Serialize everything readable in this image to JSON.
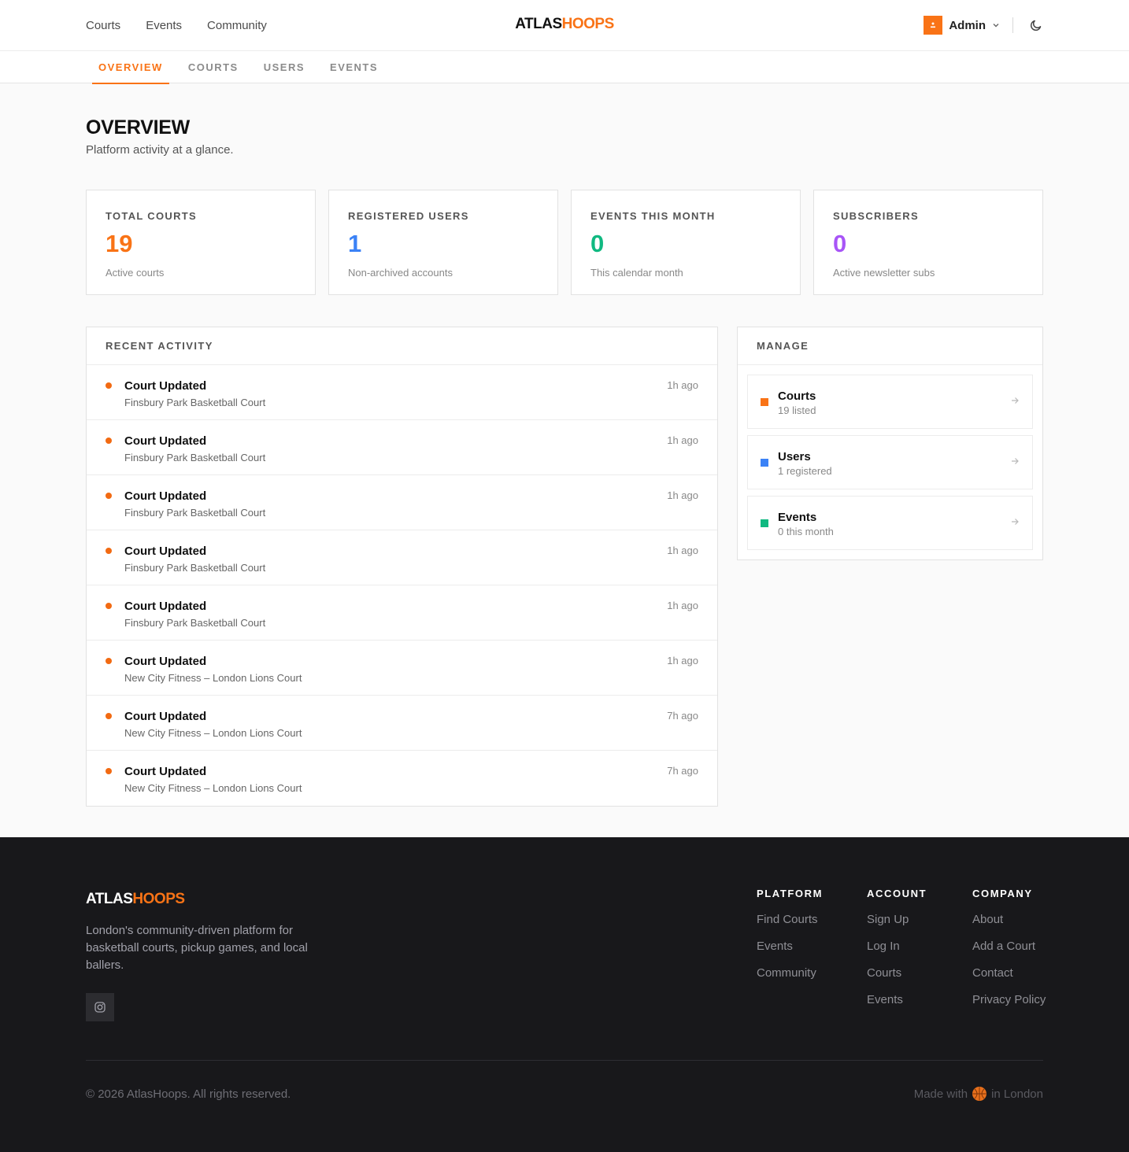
{
  "topnav": {
    "items": [
      "Courts",
      "Events",
      "Community"
    ]
  },
  "brand": {
    "part1": "ATLAS",
    "part2": "HOOPS",
    "accent_color": "#f97316"
  },
  "user": {
    "name": "Admin",
    "avatar_icon": "user-icon",
    "theme_icon": "moon-icon"
  },
  "tabs": [
    {
      "label": "OVERVIEW",
      "active": true
    },
    {
      "label": "COURTS",
      "active": false
    },
    {
      "label": "USERS",
      "active": false
    },
    {
      "label": "EVENTS",
      "active": false
    }
  ],
  "page": {
    "title": "OVERVIEW",
    "subtitle": "Platform activity at a glance."
  },
  "stats": [
    {
      "label": "TOTAL COURTS",
      "value": "19",
      "desc": "Active courts",
      "color": "#f97316"
    },
    {
      "label": "REGISTERED USERS",
      "value": "1",
      "desc": "Non-archived accounts",
      "color": "#3b82f6"
    },
    {
      "label": "EVENTS THIS MONTH",
      "value": "0",
      "desc": "This calendar month",
      "color": "#10b981"
    },
    {
      "label": "SUBSCRIBERS",
      "value": "0",
      "desc": "Active newsletter subs",
      "color": "#a855f7"
    }
  ],
  "activity": {
    "heading": "RECENT ACTIVITY",
    "items": [
      {
        "title": "Court Updated",
        "subtitle": "Finsbury Park Basketball Court",
        "time": "1h ago"
      },
      {
        "title": "Court Updated",
        "subtitle": "Finsbury Park Basketball Court",
        "time": "1h ago"
      },
      {
        "title": "Court Updated",
        "subtitle": "Finsbury Park Basketball Court",
        "time": "1h ago"
      },
      {
        "title": "Court Updated",
        "subtitle": "Finsbury Park Basketball Court",
        "time": "1h ago"
      },
      {
        "title": "Court Updated",
        "subtitle": "Finsbury Park Basketball Court",
        "time": "1h ago"
      },
      {
        "title": "Court Updated",
        "subtitle": "New City Fitness – London Lions Court",
        "time": "1h ago"
      },
      {
        "title": "Court Updated",
        "subtitle": "New City Fitness – London Lions Court",
        "time": "7h ago"
      },
      {
        "title": "Court Updated",
        "subtitle": "New City Fitness – London Lions Court",
        "time": "7h ago"
      }
    ]
  },
  "manage": {
    "heading": "MANAGE",
    "items": [
      {
        "title": "Courts",
        "subtitle": "19 listed",
        "color": "#f97316"
      },
      {
        "title": "Users",
        "subtitle": "1 registered",
        "color": "#3b82f6"
      },
      {
        "title": "Events",
        "subtitle": "0 this month",
        "color": "#10b981"
      }
    ]
  },
  "footer": {
    "description": "London's community-driven platform for basketball courts, pickup games, and local ballers.",
    "social_icon": "instagram-icon",
    "columns": [
      {
        "heading": "PLATFORM",
        "links": [
          "Find Courts",
          "Events",
          "Community"
        ]
      },
      {
        "heading": "ACCOUNT",
        "links": [
          "Sign Up",
          "Log In",
          "Courts",
          "Events"
        ]
      },
      {
        "heading": "COMPANY",
        "links": [
          "About",
          "Add a Court",
          "Contact",
          "Privacy Policy"
        ]
      }
    ],
    "copyright": "© 2026 AtlasHoops. All rights reserved.",
    "made_with_prefix": "Made with",
    "made_with_suffix": "in London",
    "made_with_icon": "basketball-icon"
  }
}
